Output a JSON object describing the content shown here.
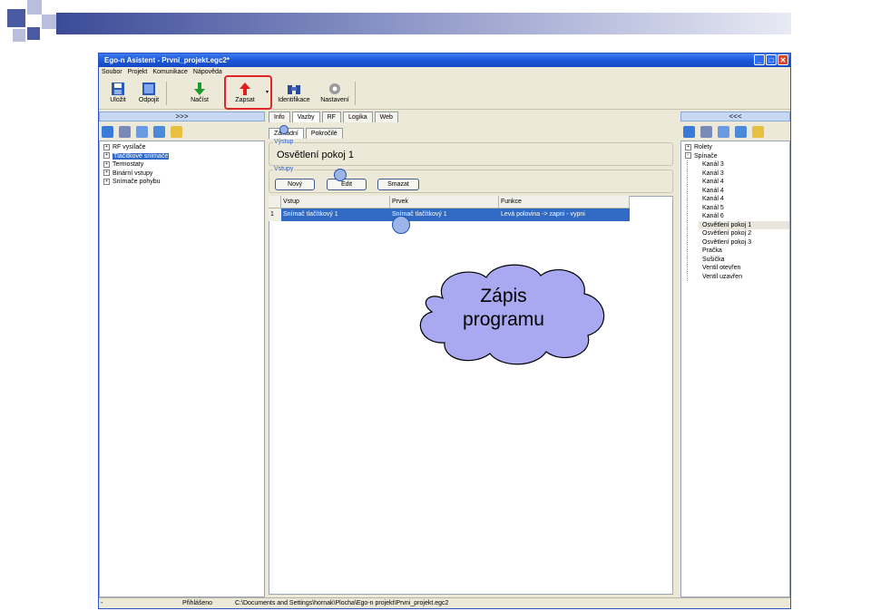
{
  "window": {
    "title": "Ego-n Asistent - Prvni_projekt.egc2*",
    "controls": [
      "_",
      "□",
      "✕"
    ]
  },
  "menu": [
    "Soubor",
    "Projekt",
    "Komunikace",
    "Nápověda"
  ],
  "toolbar": {
    "save": "Uložit",
    "disconnect": "Odpojit",
    "load": "Načíst",
    "write": "Zapsat",
    "identify": "Identifikace",
    "settings": "Nastavení"
  },
  "left_panel": {
    "header": ">>>",
    "items": [
      "RF vysílače",
      "Tlačítkové snímače",
      "Termostaty",
      "Binární vstupy",
      "Snímače pohybu"
    ]
  },
  "tabs": [
    "Info",
    "Vazby",
    "RF",
    "Logika",
    "Web"
  ],
  "subtabs": [
    "Základní",
    "Pokročilé"
  ],
  "output": {
    "label": "Výstup",
    "value": "Osvětlení pokoj 1"
  },
  "inputs": {
    "label": "Vstupy",
    "buttons": [
      "Nový",
      "Edit",
      "Smazat"
    ],
    "columns": [
      "Vstup",
      "Prvek",
      "Funkce"
    ],
    "rows": [
      {
        "num": "1",
        "input": "Snímač tlačítkový 1",
        "element": "Snímač tlačítkový 1",
        "function": "Levá polovina -> zapni - vypni"
      }
    ]
  },
  "right_panel": {
    "header": "<<<",
    "roots": [
      "Rolety",
      "Spínače"
    ],
    "items": [
      "Kanál 3",
      "Kanál 3",
      "Kanál 4",
      "Kanál 4",
      "Kanál 4",
      "Kanál 5",
      "Kanál 6",
      "Osvětlení pokoj 1",
      "Osvětlení pokoj 2",
      "Osvětlení pokoj 3",
      "Pračka",
      "Sušička",
      "Ventil otevřen",
      "Ventil uzavřen"
    ]
  },
  "status": {
    "left": "-",
    "state": "Přihlášeno",
    "path": "C:\\Documents and Settings\\hornak\\Plocha\\Ego-n projekt\\Prvni_projekt.egc2"
  },
  "callout": {
    "line1": "Zápis",
    "line2": "programu"
  }
}
